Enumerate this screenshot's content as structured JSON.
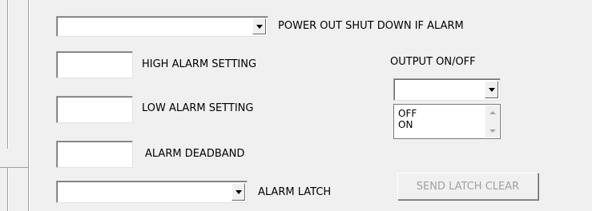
{
  "power_out": {
    "value": "",
    "label": "POWER OUT SHUT DOWN IF ALARM"
  },
  "high_alarm": {
    "value": "",
    "label": "HIGH ALARM SETTING"
  },
  "low_alarm": {
    "value": "",
    "label": "LOW ALARM SETTING"
  },
  "deadband": {
    "value": "",
    "label": "ALARM DEADBAND"
  },
  "latch": {
    "value": "",
    "label": "ALARM LATCH"
  },
  "output": {
    "label": "OUTPUT ON/OFF",
    "value": "",
    "options": [
      "OFF",
      "ON"
    ]
  },
  "send_latch_clear": {
    "label": "SEND LATCH CLEAR",
    "enabled": false
  },
  "icons": {
    "dropdown": "chevron-down-icon",
    "scroll_up": "scroll-up-icon",
    "scroll_down": "scroll-down-icon"
  }
}
